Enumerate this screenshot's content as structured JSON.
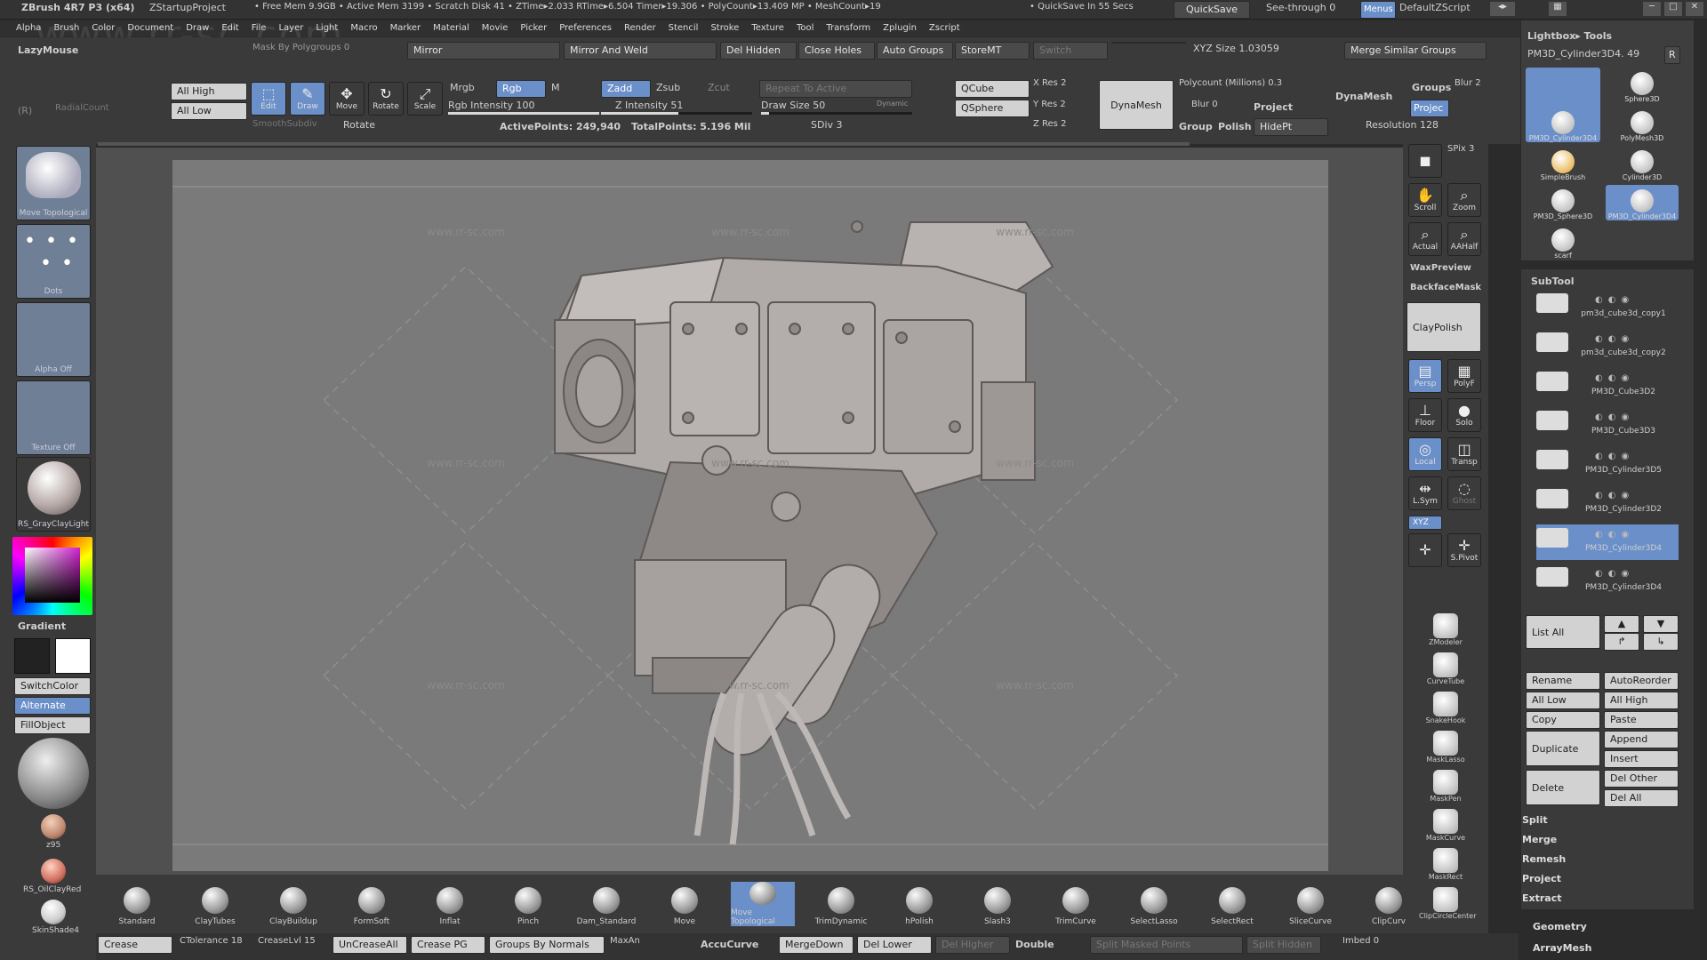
{
  "title_bar": {
    "app": "ZBrush 4R7 P3 (x64)",
    "project": "ZStartupProject",
    "stats": "• Free Mem 9.9GB • Active Mem 3199 • Scratch Disk 41 • ZTime▸2.033 RTime▸6.504 Timer▸19.306 • PolyCount▸13.409 MP • MeshCount▸19",
    "quicksave_info": "• QuickSave In 55 Secs",
    "quicksave_btn": "QuickSave",
    "see_through": "See-through 0",
    "menus_btn": "Menus",
    "script": "DefaultZScript"
  },
  "menu_bar": [
    "Alpha",
    "Brush",
    "Color",
    "Document",
    "Draw",
    "Edit",
    "File",
    "Layer",
    "Light",
    "Macro",
    "Marker",
    "Material",
    "Movie",
    "Picker",
    "Preferences",
    "Render",
    "Stencil",
    "Stroke",
    "Texture",
    "Tool",
    "Transform",
    "Zplugin",
    "Zscript"
  ],
  "toolbar1": {
    "lazymouse": "LazyMouse",
    "mask_by_polygroups": "Mask By Polygroups 0",
    "mirror": "Mirror",
    "mirror_weld": "Mirror And Weld",
    "del_hidden": "Del Hidden",
    "close_holes": "Close Holes",
    "auto_groups": "Auto Groups",
    "store_mt": "StoreMT",
    "switch": "Switch",
    "xyz_size": "XYZ Size 1.03059",
    "merge_similar": "Merge Similar Groups"
  },
  "toolbar2": {
    "all_high": "All High",
    "all_low": "All Low",
    "edit": "Edit",
    "draw": "Draw",
    "move": "Move",
    "rotate": "Rotate",
    "scale": "Scale",
    "mrgb": "Mrgb",
    "rgb": "Rgb",
    "m": "M",
    "rgb_intensity": "Rgb Intensity 100",
    "zadd": "Zadd",
    "zsub": "Zsub",
    "zcut": "Zcut",
    "z_intensity": "Z Intensity 51",
    "draw_size": "Draw Size 50",
    "dynamic": "Dynamic",
    "qcube": "QCube",
    "qsphere": "QSphere",
    "x_res": "X Res 2",
    "y_res": "Y Res 2",
    "z_res": "Z Res 2",
    "dynamesh": "DynaMesh",
    "polycount": "Polycount (Millions) 0.3",
    "blur": "Blur 0",
    "project": "Project",
    "group": "Group",
    "polish": "Polish",
    "hidept": "HidePt",
    "dynamesh_label": "DynaMesh",
    "groups": "Groups",
    "blur2": "Blur 2",
    "projec": "Projec",
    "resolution": "Resolution 128",
    "radial_count": "RadialCount",
    "rotate_label": "Rotate",
    "smooth_subdiv": "SmoothSubdiv",
    "active_points": "ActivePoints: 249,940",
    "total_points": "TotalPoints: 5.196 Mil",
    "sdiv": "SDiv 3",
    "repeat_to_active": "Repeat To Active",
    "r_label": "(R)"
  },
  "left_panel": {
    "brush": "Move Topological",
    "stroke": "Dots",
    "alpha": "Alpha Off",
    "texture": "Texture Off",
    "material": "RS_GrayClayLight",
    "gradient": "Gradient",
    "switch_color": "SwitchColor",
    "alternate": "Alternate",
    "fill_object": "FillObject",
    "z95": "z95",
    "oil_clay": "RS_OilClayRed",
    "skin_shade": "SkinShade4"
  },
  "right_dock": {
    "spix": "SPix 3",
    "scroll": "Scroll",
    "zoom": "Zoom",
    "actual": "Actual",
    "aahalf": "AAHalf",
    "wax_preview": "WaxPreview",
    "backface_mask": "BackfaceMask",
    "clay_polish": "ClayPolish",
    "persp": "Persp",
    "polyf": "PolyF",
    "floor": "Floor",
    "solo": "Solo",
    "local": "Local",
    "transp": "Transp",
    "lsym": "L.Sym",
    "ghost": "Ghost",
    "xyz": "XYZ",
    "spivot": "S.Pivot",
    "zmodeler": "ZModeler",
    "curve_tube": "CurveTube",
    "snake_hook": "SnakeHook",
    "mask_lasso": "MaskLasso",
    "mask_pen": "MaskPen",
    "mask_curve": "MaskCurve",
    "mask_rect": "MaskRect",
    "clip_circle_center": "ClipCircleCenter"
  },
  "tool_panel": {
    "lightbox_tools": "Lightbox▸ Tools",
    "current_tool": "PM3D_Cylinder3D4. 49",
    "r": "R",
    "tools": [
      "PM3D_Cylinder3D4",
      "Sphere3D",
      "PolyMesh3D",
      "SimpleBrush",
      "Cylinder3D",
      "PM3D_Sphere3D",
      "PM3D_Cylinder3D4",
      "scarf"
    ],
    "subtool_header": "SubTool",
    "subtools": [
      "pm3d_cube3d_copy1",
      "pm3d_cube3d_copy2",
      "PM3D_Cube3D2",
      "PM3D_Cube3D3",
      "PM3D_Cylinder3D5",
      "PM3D_Cylinder3D2",
      "PM3D_Cylinder3D4",
      "PM3D_Cylinder3D4"
    ],
    "list_all": "List All",
    "rename": "Rename",
    "auto_reorder": "AutoReorder",
    "all_low": "All Low",
    "all_high": "All High",
    "copy": "Copy",
    "paste": "Paste",
    "append": "Append",
    "duplicate": "Duplicate",
    "insert": "Insert",
    "delete": "Delete",
    "del_other": "Del Other",
    "del_all": "Del All",
    "split": "Split",
    "merge": "Merge",
    "remesh": "Remesh",
    "project": "Project",
    "extract": "Extract",
    "geometry": "Geometry",
    "array_mesh": "ArrayMesh"
  },
  "brush_shelf": [
    "Standard",
    "ClayTubes",
    "ClayBuildup",
    "FormSoft",
    "Inflat",
    "Pinch",
    "Dam_Standard",
    "Move",
    "Move Topological",
    "TrimDynamic",
    "hPolish",
    "Slash3",
    "TrimCurve",
    "SelectLasso",
    "SelectRect",
    "SliceCurve",
    "ClipCurv"
  ],
  "bottom_bar": {
    "crease": "Crease",
    "ctolerance": "CTolerance 18",
    "crease_lvl": "CreaseLvl 15",
    "uncrease_all": "UnCreaseAll",
    "crease_pg": "Crease PG",
    "groups_by_normals": "Groups By Normals",
    "maxan": "MaxAn",
    "accucurve": "AccuCurve",
    "merge_down": "MergeDown",
    "del_lower": "Del Lower",
    "del_higher": "Del Higher",
    "double": "Double",
    "split_masked": "Split Masked Points",
    "split_hidden": "Split Hidden",
    "imbed": "Imbed 0"
  },
  "watermark": {
    "site": "www.rr-sc.com",
    "cn": "人人素材"
  },
  "colors": {
    "canvas": "#7a7a7a",
    "ui_dark": "#2b2b2b",
    "accent_blue": "#6a8fc9"
  }
}
